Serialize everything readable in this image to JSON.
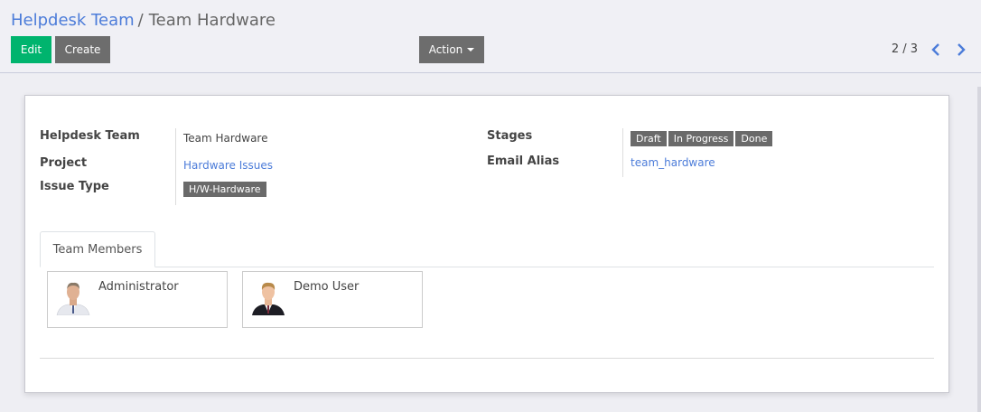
{
  "breadcrumb": {
    "parent": "Helpdesk Team",
    "separator": "/",
    "current": "Team Hardware"
  },
  "toolbar": {
    "edit_label": "Edit",
    "create_label": "Create",
    "action_label": "Action"
  },
  "pager": {
    "text": "2 / 3"
  },
  "form": {
    "helpdesk_team": {
      "label": "Helpdesk Team",
      "value": "Team Hardware"
    },
    "project": {
      "label": "Project",
      "value": "Hardware Issues"
    },
    "issue_type": {
      "label": "Issue Type",
      "value": "H/W-Hardware"
    },
    "stages": {
      "label": "Stages",
      "values": [
        "Draft",
        "In Progress",
        "Done"
      ]
    },
    "email_alias": {
      "label": "Email Alias",
      "value": "team_hardware"
    }
  },
  "tabs": {
    "team_members": "Team Members"
  },
  "members": [
    {
      "name": "Administrator",
      "icon": "avatar-admin"
    },
    {
      "name": "Demo User",
      "icon": "avatar-demo"
    }
  ],
  "colors": {
    "primary": "#00b46e",
    "secondary": "#6d6d6d",
    "link": "#4c7cd9",
    "tag": "#6a6a6a"
  }
}
